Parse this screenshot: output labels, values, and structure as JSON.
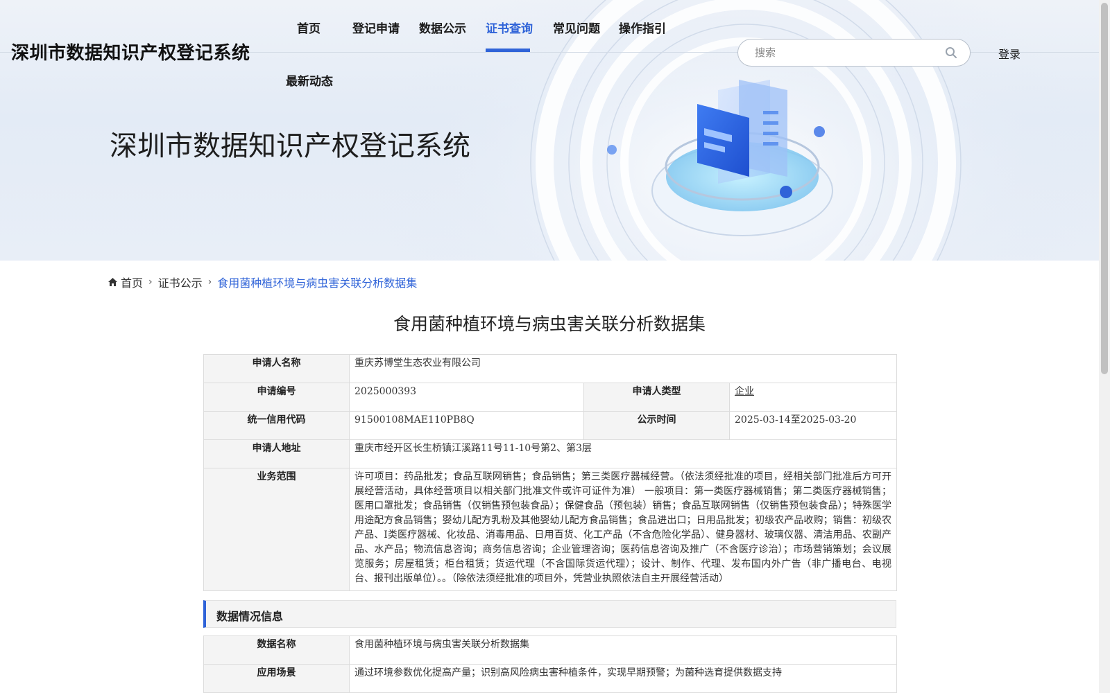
{
  "site": {
    "title": "深圳市数据知识产权登记系统"
  },
  "nav": {
    "items": [
      {
        "label": "首页"
      },
      {
        "label": "登记申请"
      },
      {
        "label": "数据公示"
      },
      {
        "label": "证书查询"
      },
      {
        "label": "常见问题"
      },
      {
        "label": "操作指引"
      },
      {
        "label": "最新动态"
      }
    ],
    "active_item": "证书查询"
  },
  "search": {
    "placeholder": "搜索"
  },
  "login": {
    "label": "登录"
  },
  "hero": {
    "title": "深圳市数据知识产权登记系统"
  },
  "breadcrumb": {
    "home": "首页",
    "section": "证书公示",
    "current": "食用菌种植环境与病虫害关联分析数据集"
  },
  "detail": {
    "title": "食用菌种植环境与病虫害关联分析数据集",
    "applicant_name_label": "申请人名称",
    "applicant_name": "重庆苏博堂生态农业有限公司",
    "application_no_label": "申请编号",
    "application_no": "2025000393",
    "applicant_type_label": "申请人类型",
    "applicant_type": "企业",
    "credit_code_label": "统一信用代码",
    "credit_code": "91500108MAE110PB8Q",
    "publicity_time_label": "公示时间",
    "publicity_time": "2025-03-14至2025-03-20",
    "address_label": "申请人地址",
    "address": "重庆市经开区长生桥镇江溪路11号11-10号第2、第3层",
    "business_scope_label": "业务范围",
    "business_scope": "许可项目：药品批发；食品互联网销售；食品销售；第三类医疗器械经营。（依法须经批准的项目，经相关部门批准后方可开展经营活动，具体经营项目以相关部门批准文件或许可证件为准） 一般项目：第一类医疗器械销售；第二类医疗器械销售；医用口罩批发；食品销售（仅销售预包装食品）；保健食品（预包装）销售；食品互联网销售（仅销售预包装食品）；特殊医学用途配方食品销售；婴幼儿配方乳粉及其他婴幼儿配方食品销售；食品进出口；日用品批发；初级农产品收购；销售：初级农产品、Ⅰ类医疗器械、化妆品、消毒用品、日用百货、化工产品（不含危险化学品）、健身器材、玻璃仪器、清洁用品、农副产品、水产品；物流信息咨询；商务信息咨询；企业管理咨询；医药信息咨询及推广（不含医疗诊治）；市场营销策划；会议展览服务；房屋租赁；柜台租赁；货运代理（不含国际货运代理）；设计、制作、代理、发布国内外广告（非广播电台、电视台、报刊出版单位）。。（除依法须经批准的项目外，凭营业执照依法自主开展经营活动）"
  },
  "data_info": {
    "section_title": "数据情况信息",
    "data_name_label": "数据名称",
    "data_name": "食用菌种植环境与病虫害关联分析数据集",
    "scenario_label": "应用场景",
    "scenario": "通过环境参数优化提高产量；识别高风险病虫害种植条件，实现早期预警；为菌种选育提供数据支持"
  },
  "colors": {
    "accent": "#2f63d8",
    "label_bg": "#f4f4f4",
    "border": "#dcdcdc"
  }
}
